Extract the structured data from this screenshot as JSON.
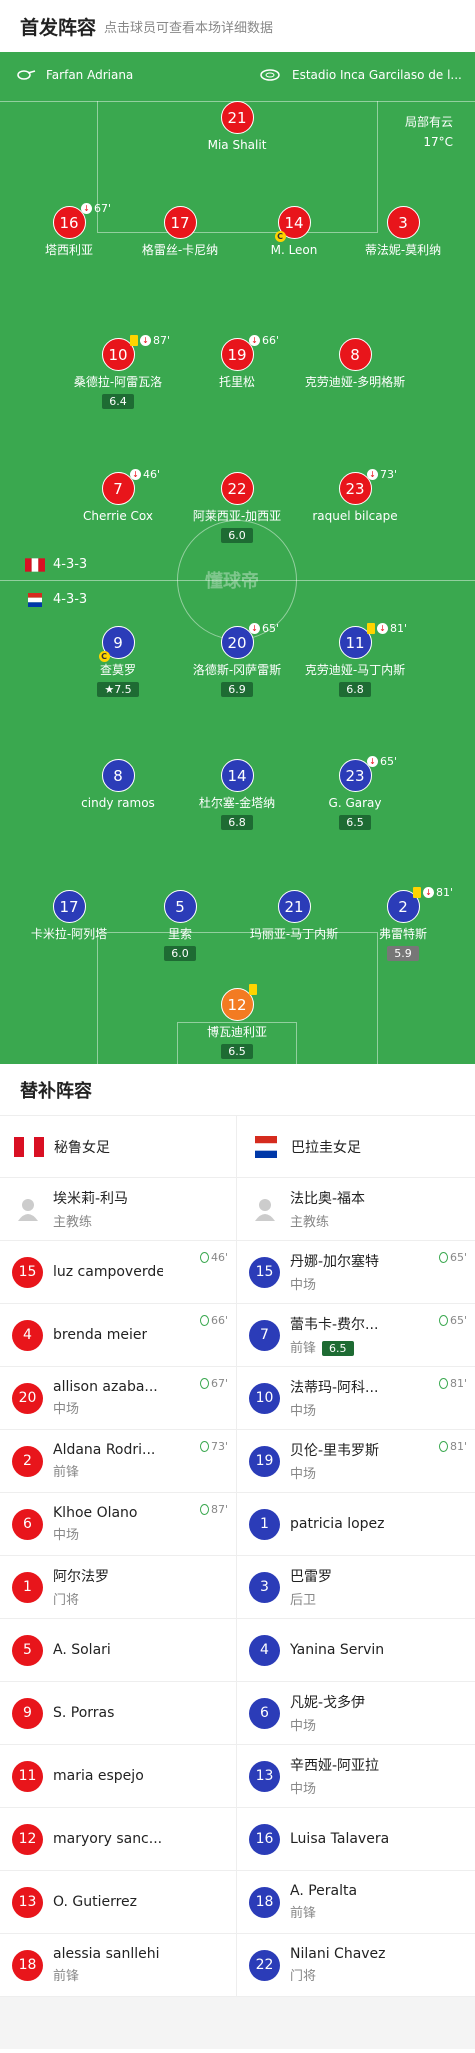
{
  "header": {
    "title": "首发阵容",
    "subtitle": "点击球员可查看本场详细数据"
  },
  "match": {
    "referee": "Farfan Adriana",
    "stadium": "Estadio Inca Garcilaso de l...",
    "weather": "局部有云",
    "temp": "17°C",
    "watermark": "懂球帝"
  },
  "home": {
    "formation": "4-3-3",
    "players": [
      {
        "num": "21",
        "name": "Mia Shalit"
      },
      {
        "num": "16",
        "name": "塔西利亚",
        "ev": "67'"
      },
      {
        "num": "17",
        "name": "格雷丝-卡尼纳"
      },
      {
        "num": "14",
        "name": "M. Leon"
      },
      {
        "num": "3",
        "name": "蒂法妮-莫利纳"
      },
      {
        "num": "10",
        "name": "桑德拉-阿雷瓦洛",
        "ev": "87'",
        "rating": "6.4"
      },
      {
        "num": "19",
        "name": "托里松",
        "ev": "66'"
      },
      {
        "num": "8",
        "name": "克劳迪娅-多明格斯"
      },
      {
        "num": "7",
        "name": "Cherrie Cox",
        "ev": "46'"
      },
      {
        "num": "22",
        "name": "阿莱西亚-加西亚",
        "rating": "6.0"
      },
      {
        "num": "23",
        "name": "raquel bilcape",
        "ev": "73'"
      }
    ]
  },
  "away": {
    "formation": "4-3-3",
    "players": [
      {
        "num": "9",
        "name": "查莫罗",
        "rating": "7.5"
      },
      {
        "num": "20",
        "name": "洛德斯-冈萨雷斯",
        "ev": "65'",
        "rating": "6.9"
      },
      {
        "num": "11",
        "name": "克劳迪娅-马丁内斯",
        "ev": "81'",
        "rating": "6.8"
      },
      {
        "num": "8",
        "name": "cindy ramos"
      },
      {
        "num": "14",
        "name": "杜尔塞-金塔纳",
        "rating": "6.8"
      },
      {
        "num": "23",
        "name": "G. Garay",
        "ev": "65'",
        "rating": "6.5"
      },
      {
        "num": "17",
        "name": "卡米拉-阿列塔"
      },
      {
        "num": "5",
        "name": "里索",
        "rating": "6.0"
      },
      {
        "num": "21",
        "name": "玛丽亚-马丁内斯"
      },
      {
        "num": "2",
        "name": "弗雷特斯",
        "ev": "81'",
        "rating": "5.9"
      },
      {
        "num": "12",
        "name": "博瓦迪利亚",
        "rating": "6.5"
      }
    ]
  },
  "subs_title": "替补阵容",
  "subs_home": {
    "team": "秘鲁女足",
    "coach": {
      "name": "埃米莉-利马",
      "role": "主教练"
    },
    "rows": [
      {
        "num": "15",
        "name": "luz campoverde",
        "min": "46'"
      },
      {
        "num": "4",
        "name": "brenda meier",
        "min": "66'"
      },
      {
        "num": "20",
        "name": "allison azaba...",
        "pos": "中场",
        "min": "67'"
      },
      {
        "num": "2",
        "name": "Aldana Rodri...",
        "pos": "前锋",
        "min": "73'"
      },
      {
        "num": "6",
        "name": "Klhoe Olano",
        "pos": "中场",
        "min": "87'"
      },
      {
        "num": "1",
        "name": "阿尔法罗",
        "pos": "门将"
      },
      {
        "num": "5",
        "name": "A. Solari"
      },
      {
        "num": "9",
        "name": "S. Porras"
      },
      {
        "num": "11",
        "name": "maria espejo"
      },
      {
        "num": "12",
        "name": "maryory sanc..."
      },
      {
        "num": "13",
        "name": "O. Gutierrez"
      },
      {
        "num": "18",
        "name": "alessia sanllehi",
        "pos": "前锋"
      }
    ]
  },
  "subs_away": {
    "team": "巴拉圭女足",
    "coach": {
      "name": "法比奥-福本",
      "role": "主教练"
    },
    "rows": [
      {
        "num": "15",
        "name": "丹娜-加尔塞特",
        "pos": "中场",
        "min": "65'"
      },
      {
        "num": "7",
        "name": "蕾韦卡-费尔...",
        "pos": "前锋",
        "rating": "6.5",
        "min": "65'"
      },
      {
        "num": "10",
        "name": "法蒂玛-阿科...",
        "pos": "中场",
        "min": "81'"
      },
      {
        "num": "19",
        "name": "贝伦-里韦罗斯",
        "pos": "中场",
        "min": "81'"
      },
      {
        "num": "1",
        "name": "patricia lopez"
      },
      {
        "num": "3",
        "name": "巴雷罗",
        "pos": "后卫"
      },
      {
        "num": "4",
        "name": "Yanina Servin"
      },
      {
        "num": "6",
        "name": "凡妮-戈多伊",
        "pos": "中场"
      },
      {
        "num": "13",
        "name": "辛西娅-阿亚拉",
        "pos": "中场"
      },
      {
        "num": "16",
        "name": "Luisa Talavera"
      },
      {
        "num": "18",
        "name": "A. Peralta",
        "pos": "前锋"
      },
      {
        "num": "22",
        "name": "Nilani Chavez",
        "pos": "门将"
      }
    ]
  }
}
